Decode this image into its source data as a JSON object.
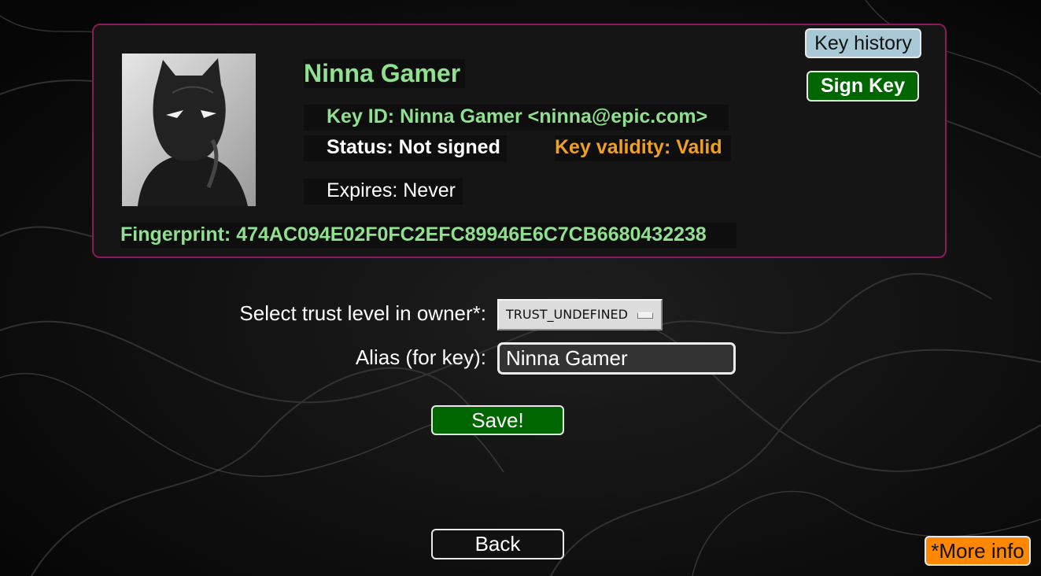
{
  "key": {
    "name": "Ninna Gamer",
    "key_id": "Key ID: Ninna Gamer <ninna@epic.com>",
    "status": "Status: Not signed",
    "validity": "Key validity: Valid",
    "expires": "Expires: Never",
    "fingerprint": "Fingerprint: 474AC094E02F0FC2EFC89946E6C7CB6680432238"
  },
  "actions": {
    "key_history_label": "Key history",
    "sign_key_label": "Sign Key"
  },
  "form": {
    "trust_label": "Select trust level in owner*:",
    "trust_value": "TRUST_UNDEFINED",
    "alias_label": "Alias (for key):",
    "alias_value": "Ninna Gamer",
    "save_label": "Save!"
  },
  "nav": {
    "back_label": "Back",
    "more_info_label": "*More info"
  },
  "colors": {
    "accent_green": "#8fe08f",
    "validity_orange": "#f0a020",
    "button_green": "#006600",
    "card_border": "#8b1a5a",
    "more_info_orange": "#ff8800"
  },
  "icons": {
    "avatar": "masked-figure-avatar",
    "select_indicator": "dropdown-indicator-icon"
  }
}
